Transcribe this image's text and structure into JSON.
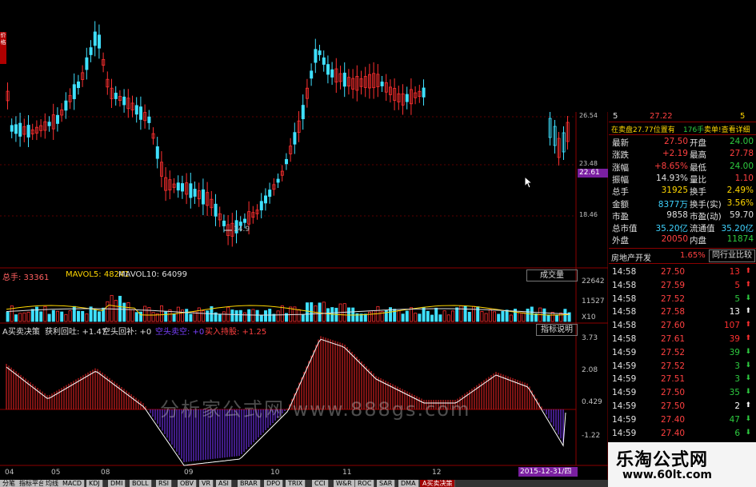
{
  "price_chart": {
    "axis_labels": [
      "26.54",
      "23.48",
      "18.46"
    ],
    "current_price_tag": "22.61",
    "low_marker": "14.9",
    "side_tab": "价格"
  },
  "volume_panel": {
    "label_total": "总手: 33361",
    "label_mavol5": "MAVOL5: 48241",
    "label_mavol10": "MAVOL10: 64099",
    "dropdown": "成交量",
    "axis_labels": [
      "22642",
      "11527",
      "X10"
    ]
  },
  "indicator_panel": {
    "title": "A买卖决策",
    "profit_retrace": "获利回吐: +1.47",
    "short_cover": "空头回补: +0",
    "bear_sell": "空头卖空: +0",
    "buy_hold": "买入持股: +1.25",
    "explain_button": "指标说明",
    "axis_labels": [
      "3.73",
      "2.08",
      "0.429",
      "-1.22"
    ],
    "watermark_text": "分析家公式网  www.888gs.com"
  },
  "time_axis": {
    "months": [
      "04",
      "05",
      "08",
      "09",
      "10",
      "11",
      "12"
    ],
    "date_tag": "2015-12-31/四"
  },
  "quote_panel": {
    "header_left": "5",
    "header_price": "27.22",
    "header_right": "5",
    "status_line": "在卖盘27.77位置有",
    "status_count": "176手",
    "status_alert": "卖单!查看详细",
    "rows": [
      {
        "k1": "最新",
        "v1": "27.50",
        "k2": "开盘",
        "v2": "24.00",
        "c1": "#ff4040",
        "c2": "#2ecc40"
      },
      {
        "k1": "涨跌",
        "v1": "+2.19",
        "k2": "最高",
        "v2": "27.78",
        "c1": "#ff4040",
        "c2": "#ff4040"
      },
      {
        "k1": "涨幅",
        "v1": "+8.65%",
        "k2": "最低",
        "v2": "24.00",
        "c1": "#ff4040",
        "c2": "#2ecc40"
      },
      {
        "k1": "振幅",
        "v1": "14.93%",
        "k2": "量比",
        "v2": "1.10",
        "c1": "#e0e0e0",
        "c2": "#ff4040"
      },
      {
        "k1": "总手",
        "v1": "31925",
        "k2": "换手",
        "v2": "2.49%",
        "c1": "#ffd700",
        "c2": "#ffd700"
      },
      {
        "k1": "金额",
        "v1": "8377万",
        "k2": "换手(实)",
        "v2": "3.56%",
        "c1": "#3fd3ff",
        "c2": "#ffd700"
      },
      {
        "k1": "市盈",
        "v1": "9858",
        "k2": "市盈(动)",
        "v2": "59.70",
        "c1": "#e0e0e0",
        "c2": "#e0e0e0"
      },
      {
        "k1": "总市值",
        "v1": "35.20亿",
        "k2": "流通值",
        "v2": "35.20亿",
        "c1": "#3fd3ff",
        "c2": "#3fd3ff"
      },
      {
        "k1": "外盘",
        "v1": "20050",
        "k2": "内盘",
        "v2": "11874",
        "c1": "#ff4040",
        "c2": "#2ecc40"
      }
    ],
    "sector": "房地产开发",
    "sector_change": "1.65%",
    "compare_button": "同行业比较"
  },
  "ticks": [
    {
      "time": "14:58",
      "price": "27.50",
      "vol": "13",
      "dir": "up"
    },
    {
      "time": "14:58",
      "price": "27.59",
      "vol": "5",
      "dir": "up"
    },
    {
      "time": "14:58",
      "price": "27.52",
      "vol": "5",
      "dir": "down"
    },
    {
      "time": "14:58",
      "price": "27.58",
      "vol": "13",
      "dir": "up-white"
    },
    {
      "time": "14:58",
      "price": "27.60",
      "vol": "107",
      "dir": "up"
    },
    {
      "time": "14:58",
      "price": "27.61",
      "vol": "39",
      "dir": "up"
    },
    {
      "time": "14:59",
      "price": "27.52",
      "vol": "39",
      "dir": "down"
    },
    {
      "time": "14:59",
      "price": "27.52",
      "vol": "3",
      "dir": "down"
    },
    {
      "time": "14:59",
      "price": "27.51",
      "vol": "3",
      "dir": "down"
    },
    {
      "time": "14:59",
      "price": "27.50",
      "vol": "35",
      "dir": "down"
    },
    {
      "time": "14:59",
      "price": "27.50",
      "vol": "2",
      "dir": "up-white"
    },
    {
      "time": "14:59",
      "price": "27.40",
      "vol": "47",
      "dir": "down"
    },
    {
      "time": "14:59",
      "price": "27.40",
      "vol": "6",
      "dir": "down"
    }
  ],
  "colors": {
    "up": "#ff3030",
    "down": "#3fe0ff",
    "green": "#2ecc40",
    "yellow": "#ffd700"
  },
  "bottom_tabs": [
    "分笔",
    "指标平台",
    "均线",
    "MACD",
    "KDJ",
    "DMI",
    "BOLL",
    "RSI",
    "OBV",
    "VR",
    "ASI",
    "BRAR",
    "DPO",
    "TRIX",
    "CCI",
    "W&R",
    "ROC",
    "SAR",
    "DMA",
    "A买卖决策"
  ],
  "watermark": {
    "title": "乐淘公式网",
    "url": "www.60lt.com"
  }
}
